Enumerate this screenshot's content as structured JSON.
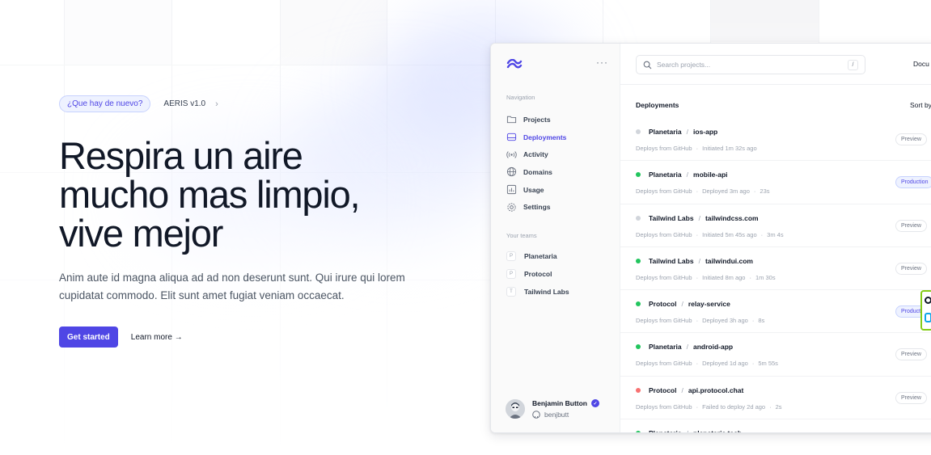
{
  "hero": {
    "announce_pill": "¿Que hay de nuevo?",
    "version_label": "AERIS v1.0",
    "headline": [
      "Respira un aire",
      "mucho mas limpio,",
      "vive mejor"
    ],
    "lead": "Anim aute id magna aliqua ad ad non deserunt sunt. Qui irure qui lorem cupidatat commodo. Elit sunt amet fugiat veniam occaecat.",
    "primary_cta": "Get started",
    "secondary_cta": "Learn more →"
  },
  "sidebar": {
    "nav_label": "Navigation",
    "nav_items": [
      {
        "label": "Projects",
        "icon": "folder-icon",
        "active": false
      },
      {
        "label": "Deployments",
        "icon": "server-icon",
        "active": true
      },
      {
        "label": "Activity",
        "icon": "signal-icon",
        "active": false
      },
      {
        "label": "Domains",
        "icon": "globe-icon",
        "active": false
      },
      {
        "label": "Usage",
        "icon": "chart-icon",
        "active": false
      },
      {
        "label": "Settings",
        "icon": "gear-icon",
        "active": false
      }
    ],
    "teams_label": "Your teams",
    "teams": [
      {
        "initial": "P",
        "label": "Planetaria"
      },
      {
        "initial": "P",
        "label": "Protocol"
      },
      {
        "initial": "T",
        "label": "Tailwind Labs"
      }
    ],
    "user": {
      "name": "Benjamin Button",
      "handle": "benjbutt"
    }
  },
  "topbar": {
    "search_placeholder": "Search projects...",
    "search_shortcut": "/",
    "docs_link": "Docu"
  },
  "deployments": {
    "title": "Deployments",
    "sort_label": "Sort by",
    "rows": [
      {
        "team": "Planetaria",
        "project": "ios-app",
        "source": "Deploys from GitHub",
        "status": "Initiated 1m 32s ago",
        "duration": "",
        "tag": "Preview",
        "dot": "#d1d5db"
      },
      {
        "team": "Planetaria",
        "project": "mobile-api",
        "source": "Deploys from GitHub",
        "status": "Deployed 3m ago",
        "duration": "23s",
        "tag": "Production",
        "dot": "#22c55e"
      },
      {
        "team": "Tailwind Labs",
        "project": "tailwindcss.com",
        "source": "Deploys from GitHub",
        "status": "Initiated 5m 45s ago",
        "duration": "3m 4s",
        "tag": "Preview",
        "dot": "#d1d5db"
      },
      {
        "team": "Tailwind Labs",
        "project": "tailwindui.com",
        "source": "Deploys from GitHub",
        "status": "Initiated 8m ago",
        "duration": "1m 30s",
        "tag": "Preview",
        "dot": "#22c55e"
      },
      {
        "team": "Protocol",
        "project": "relay-service",
        "source": "Deploys from GitHub",
        "status": "Deployed 3h ago",
        "duration": "8s",
        "tag": "Production",
        "dot": "#22c55e"
      },
      {
        "team": "Planetaria",
        "project": "android-app",
        "source": "Deploys from GitHub",
        "status": "Deployed 1d ago",
        "duration": "5m 55s",
        "tag": "Preview",
        "dot": "#22c55e"
      },
      {
        "team": "Protocol",
        "project": "api.protocol.chat",
        "source": "Deploys from GitHub",
        "status": "Failed to deploy 2d ago",
        "duration": "2s",
        "tag": "Preview",
        "dot": "#f87171"
      },
      {
        "team": "Planetaria",
        "project": "planetaria.tech",
        "source": "",
        "status": "",
        "duration": "",
        "tag": "",
        "dot": "#22c55e"
      }
    ]
  },
  "colors": {
    "accent": "#4f46e5",
    "success": "#22c55e",
    "error": "#f87171",
    "pending": "#d1d5db"
  }
}
